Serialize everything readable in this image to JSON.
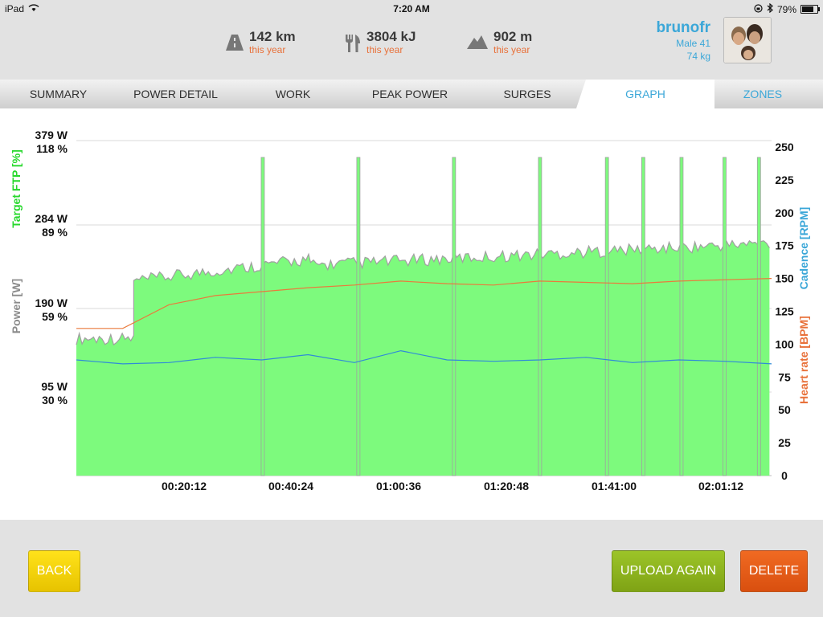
{
  "status": {
    "device": "iPad",
    "time": "7:20 AM",
    "battery": "79%"
  },
  "stats": [
    {
      "icon": "road-icon",
      "value": "142 km",
      "sub": "this year"
    },
    {
      "icon": "fork-knife-icon",
      "value": "3804 kJ",
      "sub": "this year"
    },
    {
      "icon": "mountain-icon",
      "value": "902 m",
      "sub": "this year"
    }
  ],
  "profile": {
    "name": "brunofr",
    "gender_age": "Male 41",
    "weight": "74 kg"
  },
  "tabs": [
    "SUMMARY",
    "POWER DETAIL",
    "WORK",
    "PEAK POWER",
    "SURGES",
    "GRAPH",
    "ZONES"
  ],
  "active_tab": "GRAPH",
  "colors": {
    "accent": "#3ba7d8",
    "orange": "#e8713a",
    "power_fill": "#7dfa7d",
    "power_line": "#a0a0a0",
    "cadence": "#2f8bd8",
    "hr": "#ea7a3c",
    "back": "#f2d000",
    "upload": "#8db31c",
    "delete": "#e85a16"
  },
  "chart_data": {
    "type": "area",
    "left_axis_labels": [
      {
        "power": "379 W",
        "ftp": "118 %"
      },
      {
        "power": "284 W",
        "ftp": "89 %"
      },
      {
        "power": "190 W",
        "ftp": "59 %"
      },
      {
        "power": "95 W",
        "ftp": "30 %"
      }
    ],
    "left_axis_titles": {
      "power": "Power [W]",
      "ftp": "Target FTP [%]"
    },
    "right_axis_ticks": [
      250,
      225,
      200,
      175,
      150,
      125,
      100,
      75,
      50,
      25,
      0
    ],
    "right_axis_titles": {
      "cadence": "Cadence [RPM]",
      "hr": "Heart rate [BPM]"
    },
    "x_ticks": [
      "00:20:12",
      "00:40:24",
      "01:00:36",
      "01:20:48",
      "01:41:00",
      "02:01:12"
    ],
    "x_range_seconds": [
      0,
      7272
    ],
    "y_range_watts": [
      0,
      379
    ],
    "power_segments": [
      {
        "from": 0,
        "to": 600,
        "watts": 155
      },
      {
        "from": 600,
        "to": 2450,
        "watts": 220
      },
      {
        "from": 2450,
        "to": 7250,
        "watts": 238
      }
    ],
    "power_spikes_seconds": [
      1950,
      2950,
      3950,
      4850,
      5550,
      5930,
      6330,
      6780,
      7140
    ],
    "cadence_rpm": [
      88,
      85,
      86,
      90,
      88,
      92,
      86,
      95,
      88,
      87,
      88,
      90,
      86,
      88,
      87,
      85
    ],
    "heart_rate_bpm": [
      112,
      112,
      130,
      137,
      140,
      143,
      145,
      148,
      146,
      145,
      148,
      147,
      146,
      148,
      149,
      150
    ]
  },
  "buttons": {
    "back": "BACK",
    "upload": "UPLOAD AGAIN",
    "delete": "DELETE"
  }
}
